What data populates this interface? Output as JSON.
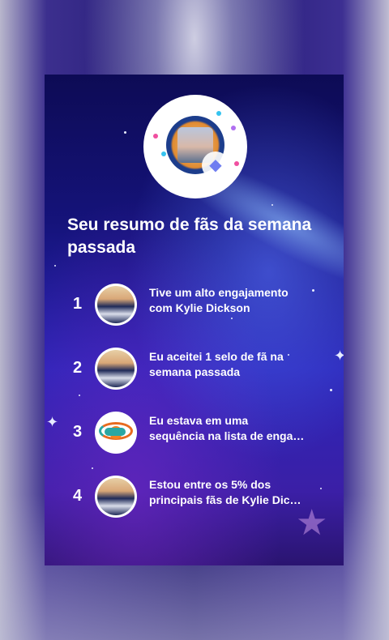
{
  "summary": {
    "title": "Seu resumo de fãs da semana passada",
    "items": [
      {
        "rank": "1",
        "line1": "Tive um alto engajamento",
        "line2": "com Kylie Dickson",
        "thumb": "person-photo"
      },
      {
        "rank": "2",
        "line1": "Eu aceitei 1 selo de fã na",
        "line2": "semana passada",
        "thumb": "person-photo"
      },
      {
        "rank": "3",
        "line1": "Eu estava em uma",
        "line2": "sequência na lista de enga…",
        "thumb": "dolphins-logo"
      },
      {
        "rank": "4",
        "line1": "Estou entre os 5% dos",
        "line2": "principais fãs de Kylie Dic…",
        "thumb": "person-photo"
      }
    ]
  },
  "colors": {
    "card_top": "#0d0b55",
    "card_mid": "#2a25b8",
    "card_bottom": "#2a1470",
    "text": "#ffffff",
    "logo_orange": "#f58220",
    "logo_teal": "#2aa7a3"
  },
  "icons": {
    "badge": "diamond-icon",
    "decor": "sparkle-icon"
  }
}
